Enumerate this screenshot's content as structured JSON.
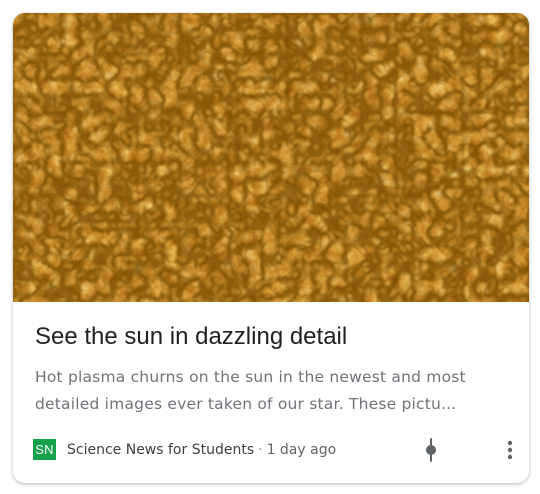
{
  "card": {
    "headline": "See the sun in dazzling detail",
    "snippet": "Hot plasma churns on the sun in the newest and most detailed images ever taken of our star. These pictu...",
    "hero_image": {
      "subject": "solar surface granulation close-up",
      "colors": {
        "deep": "#4a2300",
        "mid": "#c27a12",
        "bright": "#ffd66b"
      }
    }
  },
  "source": {
    "logo_text": "SN",
    "logo_color": "#15a24a",
    "name": "Science News for Students",
    "separator": "·",
    "time": "1 day ago"
  },
  "actions": {
    "related_icon": "related-coverage-icon",
    "more_icon": "more-vert-icon"
  },
  "colors": {
    "headline": "#202124",
    "snippet": "#6f7378",
    "meta": "#3c4043",
    "icon": "#5f6368"
  }
}
